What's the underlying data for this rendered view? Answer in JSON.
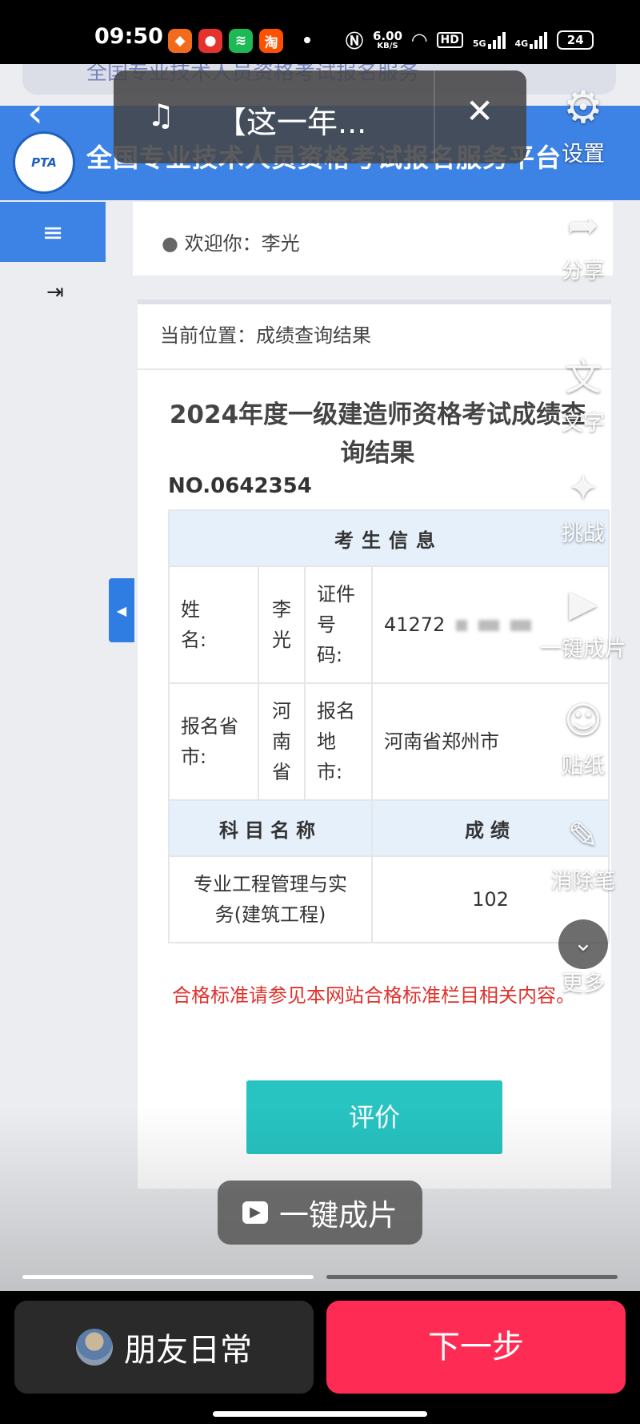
{
  "status": {
    "time": "09:50",
    "apps": [
      {
        "icon": "app-orange-icon",
        "color": "#f26b1d",
        "glyph": "◆"
      },
      {
        "icon": "app-red-icon",
        "color": "#e5322d",
        "glyph": "●"
      },
      {
        "icon": "app-green-icon",
        "color": "#1db954",
        "glyph": "≋"
      },
      {
        "icon": "taobao-icon",
        "color": "#ff5000",
        "glyph": "淘"
      }
    ],
    "speed": "6.00",
    "speed_unit": "KB/S",
    "hd": "HD",
    "net1": "5G",
    "net2": "4G",
    "battery": "24"
  },
  "browser": {
    "url_text": "全国专业技术人员资格考试报名服务"
  },
  "site": {
    "logo": "PTA",
    "title": "全国专业技术人员资格考试报名服务平台"
  },
  "nav": {
    "menu_glyph": "≡",
    "login_glyph": "⇥"
  },
  "welcome": {
    "icon": "user-icon",
    "text": "欢迎你：李光"
  },
  "panel": {
    "breadcrumb": "当前位置：成绩查询结果",
    "title": "2024年度一级建造师资格考试成绩查询结果",
    "number": "NO.0642354",
    "table": {
      "header": "考生信息",
      "name_label": [
        "姓",
        "名:"
      ],
      "name_value": [
        "李",
        "光"
      ],
      "id_label": [
        "证件",
        "号",
        "码:"
      ],
      "id_value": "41272",
      "prov_label": [
        "报名省",
        "市:"
      ],
      "prov_value": [
        "河",
        "南",
        "省"
      ],
      "city_label": [
        "报名",
        "地",
        "市:"
      ],
      "city_value": "河南省郑州市",
      "subject_header": "科目名称",
      "score_header": "成绩",
      "subject_name": [
        "专业工程管理与实",
        "务(建筑工程)"
      ],
      "score": "102"
    },
    "pass_note": "合格标准请参见本网站合格标准栏目相关内容。",
    "evaluate_button": "评价"
  },
  "music": {
    "note_glyph": "♫",
    "title": "【这一年...",
    "close_glyph": "✕"
  },
  "tools": [
    {
      "name": "settings",
      "icon": "gear-icon",
      "glyph": "⚙",
      "label": "设置"
    },
    {
      "name": "share",
      "icon": "share-icon",
      "glyph": "➦",
      "label": "分享"
    },
    {
      "name": "text",
      "icon": "text-icon",
      "glyph": "文",
      "label": "文字"
    },
    {
      "name": "challenge",
      "icon": "challenge-icon",
      "glyph": "✦",
      "label": "挑战"
    },
    {
      "name": "oneclick",
      "icon": "clapper-icon",
      "glyph": "▶",
      "label": "一键成片"
    },
    {
      "name": "sticker",
      "icon": "sticker-icon",
      "glyph": "☺",
      "label": "贴纸"
    },
    {
      "name": "eraser",
      "icon": "eraser-icon",
      "glyph": "✎",
      "label": "消除笔"
    },
    {
      "name": "more",
      "icon": "chevron-down-icon",
      "glyph": "⌄",
      "label": "更多"
    }
  ],
  "oneclick_pill": {
    "icon": "clapper-icon",
    "label": "一键成片"
  },
  "bottom": {
    "friend_label": "朋友日常",
    "next_label": "下一步"
  },
  "colors": {
    "brand_blue": "#3d83e6",
    "teal_button": "#27c4c2",
    "next_red": "#fe2c55",
    "note_red": "#e0322c"
  }
}
